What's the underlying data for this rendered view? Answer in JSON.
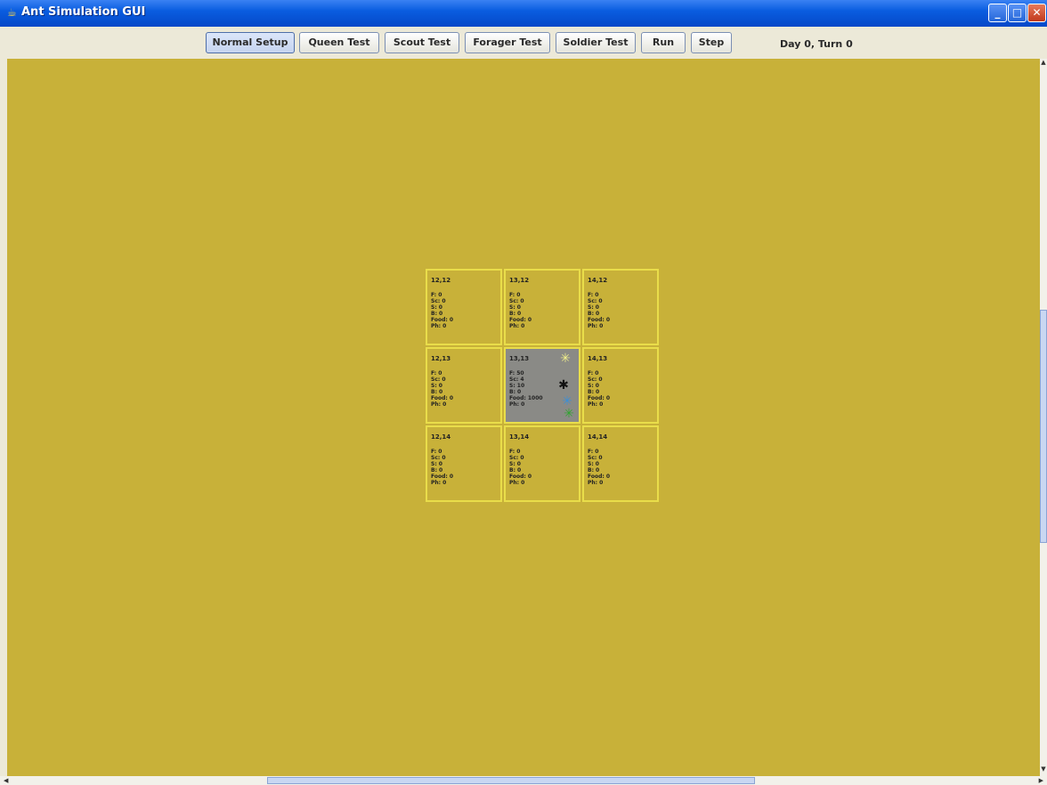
{
  "window": {
    "title": "Ant Simulation GUI",
    "app_icon": "java-cup-icon"
  },
  "toolbar": {
    "buttons": [
      "Normal Setup",
      "Queen Test",
      "Scout Test",
      "Forager Test",
      "Soldier Test",
      "Run",
      "Step"
    ],
    "status": "Day 0, Turn 0"
  },
  "colors": {
    "terrain": "#c8b139",
    "cell_border": "#e9dd4a",
    "colony_cell": "#8a8a86"
  },
  "grid": {
    "cells": [
      {
        "coord": "12,12",
        "stats": [
          "F: 0",
          "Sc: 0",
          "S: 0",
          "B: 0",
          "Food: 0",
          "Ph: 0"
        ]
      },
      {
        "coord": "13,12",
        "stats": [
          "F: 0",
          "Sc: 0",
          "S: 0",
          "B: 0",
          "Food: 0",
          "Ph: 0"
        ]
      },
      {
        "coord": "14,12",
        "stats": [
          "F: 0",
          "Sc: 0",
          "S: 0",
          "B: 0",
          "Food: 0",
          "Ph: 0"
        ]
      },
      {
        "coord": "12,13",
        "stats": [
          "F: 0",
          "Sc: 0",
          "S: 0",
          "B: 0",
          "Food: 0",
          "Ph: 0"
        ]
      },
      {
        "coord": "13,13",
        "stats": [
          "F: 50",
          "Sc: 4",
          "S: 10",
          "B: 0",
          "Food: 1000",
          "Ph: 0"
        ]
      },
      {
        "coord": "14,13",
        "stats": [
          "F: 0",
          "Sc: 0",
          "S: 0",
          "B: 0",
          "Food: 0",
          "Ph: 0"
        ]
      },
      {
        "coord": "12,14",
        "stats": [
          "F: 0",
          "Sc: 0",
          "S: 0",
          "B: 0",
          "Food: 0",
          "Ph: 0"
        ]
      },
      {
        "coord": "13,14",
        "stats": [
          "F: 0",
          "Sc: 0",
          "S: 0",
          "B: 0",
          "Food: 0",
          "Ph: 0"
        ]
      },
      {
        "coord": "14,14",
        "stats": [
          "F: 0",
          "Sc: 0",
          "S: 0",
          "B: 0",
          "Food: 0",
          "Ph: 0"
        ]
      }
    ],
    "colony_ants": [
      {
        "icon": "scout-ant-icon",
        "color": "#f2f08a"
      },
      {
        "icon": "queen-ant-icon",
        "color": "#111111"
      },
      {
        "icon": "forager-ant-icon",
        "color": "#3a8fd8"
      },
      {
        "icon": "soldier-ant-icon",
        "color": "#2fa52f"
      }
    ]
  }
}
